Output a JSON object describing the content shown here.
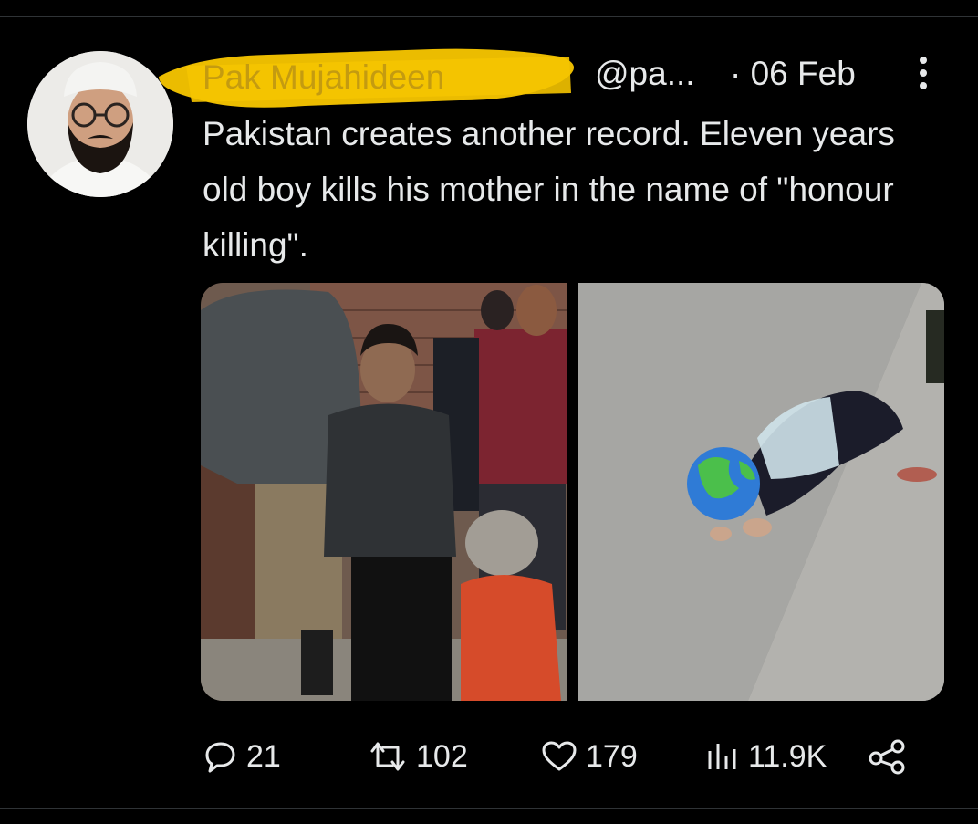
{
  "tweet": {
    "author_name": "Pak Mujahideen",
    "handle": "@pa...",
    "date": "· 06 Feb",
    "text": "Pakistan creates another record. Eleven years old boy kills his mother in the name of \"honour killing\".",
    "more_icon": "more-vertical-icon"
  },
  "actions": {
    "replies": "21",
    "retweets": "102",
    "likes": "179",
    "views": "11.9K",
    "reply_icon": "reply-icon",
    "retweet_icon": "retweet-icon",
    "like_icon": "heart-icon",
    "views_icon": "analytics-icon",
    "share_icon": "share-icon"
  },
  "colors": {
    "background": "#000000",
    "text": "#e7e9ea",
    "redaction": "#f5c400",
    "divider": "#2f3336"
  }
}
